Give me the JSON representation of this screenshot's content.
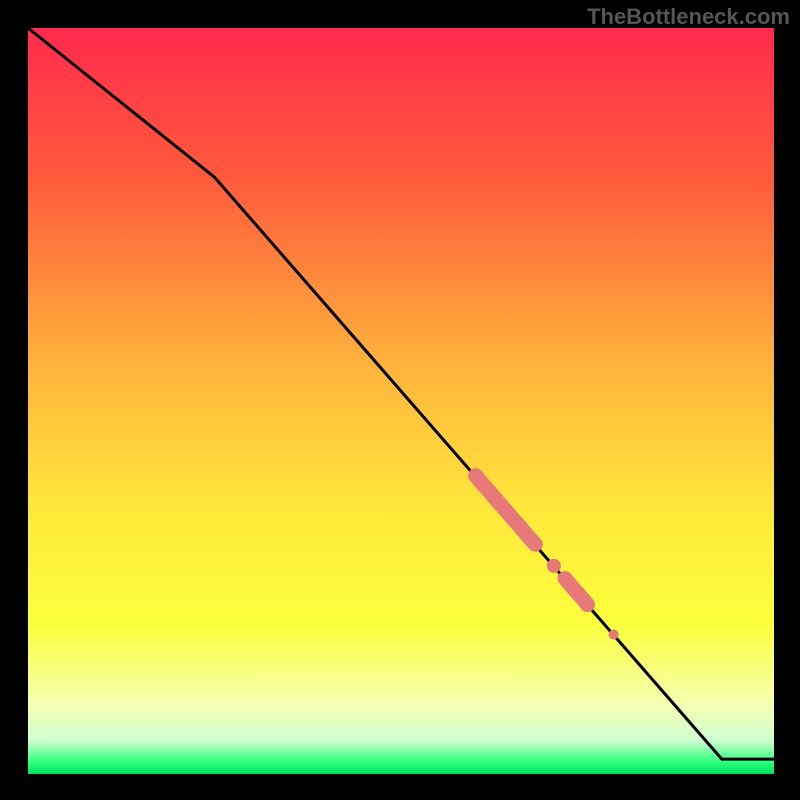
{
  "watermark": "TheBottleneck.com",
  "chart_data": {
    "type": "line",
    "title": "",
    "xlabel": "",
    "ylabel": "",
    "xlim": [
      0,
      100
    ],
    "ylim": [
      0,
      100
    ],
    "series": [
      {
        "name": "curve",
        "x": [
          0,
          25,
          93,
          100
        ],
        "y": [
          100,
          80,
          2,
          2
        ],
        "style": "line-black"
      },
      {
        "name": "highlight-cluster-1",
        "x": [
          60,
          61,
          62,
          63,
          64,
          65,
          66,
          67,
          68
        ],
        "y": [
          40,
          38.8,
          37.7,
          36.5,
          35.4,
          34.2,
          33.1,
          31.9,
          30.8
        ],
        "style": "thick-salmon"
      },
      {
        "name": "highlight-dot-2",
        "x": [
          70.5
        ],
        "y": [
          27.9
        ],
        "style": "dot-salmon"
      },
      {
        "name": "highlight-cluster-3",
        "x": [
          72,
          73,
          74,
          75
        ],
        "y": [
          26.2,
          25.0,
          23.9,
          22.7
        ],
        "style": "thick-salmon"
      },
      {
        "name": "highlight-dot-4",
        "x": [
          78.5
        ],
        "y": [
          18.7
        ],
        "style": "dot-salmon-small"
      }
    ],
    "gradient_stops": [
      {
        "offset": 0.0,
        "color": "#ff2a4d"
      },
      {
        "offset": 0.2,
        "color": "#ff5a3c"
      },
      {
        "offset": 0.45,
        "color": "#ffb23c"
      },
      {
        "offset": 0.65,
        "color": "#ffe93c"
      },
      {
        "offset": 0.8,
        "color": "#fbff3c"
      },
      {
        "offset": 0.905,
        "color": "#f6ffb0"
      },
      {
        "offset": 0.955,
        "color": "#cfffd0"
      },
      {
        "offset": 0.985,
        "color": "#2aff7a"
      },
      {
        "offset": 1.0,
        "color": "#00e05c"
      }
    ]
  }
}
